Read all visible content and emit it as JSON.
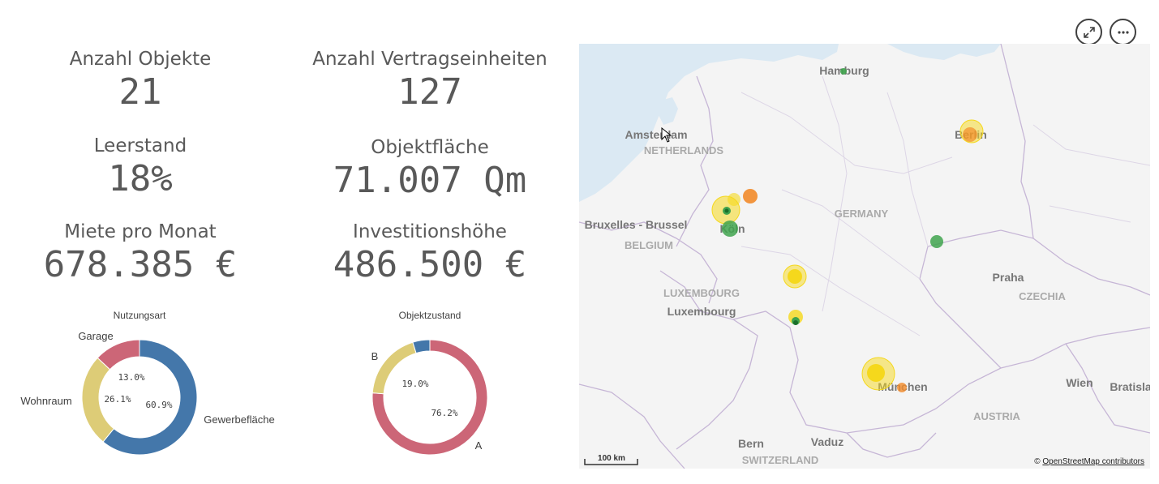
{
  "kpis": {
    "objekte": {
      "label": "Anzahl Objekte",
      "value": "21"
    },
    "vertragseinheiten": {
      "label": "Anzahl Vertragseinheiten",
      "value": "127"
    },
    "leerstand": {
      "label": "Leerstand",
      "value": "18%"
    },
    "objektflaeche": {
      "label": "Objektfläche",
      "value": "71.007 Qm"
    },
    "miete": {
      "label": "Miete pro Monat",
      "value": "678.385 €"
    },
    "investition": {
      "label": "Investitionshöhe",
      "value": "486.500 €"
    }
  },
  "donut_nutzungsart": {
    "title": "Nutzungsart",
    "slices": [
      {
        "label": "Gewerbefläche",
        "pct_label": "60.9%",
        "value": 60.9,
        "color": "#4477aa"
      },
      {
        "label": "Wohnraum",
        "pct_label": "26.1%",
        "value": 26.1,
        "color": "#ddcc77"
      },
      {
        "label": "Garage",
        "pct_label": "13.0%",
        "value": 13.0,
        "color": "#cc6677"
      }
    ]
  },
  "donut_objektzustand": {
    "title": "Objektzustand",
    "slices": [
      {
        "label": "A",
        "pct_label": "76.2%",
        "value": 76.2,
        "color": "#cc6677"
      },
      {
        "label": "B",
        "pct_label": "19.0%",
        "value": 19.0,
        "color": "#ddcc77"
      },
      {
        "label": "",
        "pct_label": "",
        "value": 4.8,
        "color": "#4477aa"
      }
    ]
  },
  "map": {
    "labels": {
      "hamburg": "Hamburg",
      "amsterdam": "Amsterdam",
      "netherlands": "NETHERLANDS",
      "berlin": "Berlin",
      "bruxelles": "Bruxelles - Brussel",
      "belgium": "BELGIUM",
      "koeln": "Köln",
      "germany": "GERMANY",
      "luxembourg_country": "LUXEMBOURG",
      "luxembourg_city": "Luxembourg",
      "praha": "Praha",
      "czechia": "CZECHIA",
      "muenchen": "München",
      "wien": "Wien",
      "bratislava": "Bratisla",
      "austria": "AUSTRIA",
      "bern": "Bern",
      "vaduz": "Vaduz",
      "switzerland": "SWITZERLAND"
    },
    "scale_label": "100 km",
    "attribution_prefix": "© ",
    "attribution_link": "OpenStreetMap contributors",
    "colors": {
      "water": "#dbe9f3",
      "land": "#f4f4f4",
      "border": "#c8b8d8",
      "yellow": "#f5d81c",
      "orange": "#f28b2a",
      "green": "#3fa34d"
    }
  },
  "toolbar": {
    "expand_icon": "expand-icon",
    "more_icon": "more-icon"
  }
}
